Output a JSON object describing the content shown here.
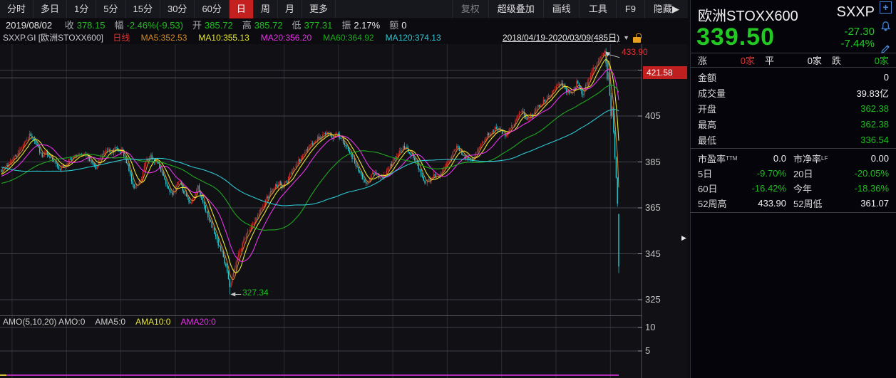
{
  "toolbar": {
    "tabs": [
      {
        "name": "fenshi",
        "label": "分时",
        "active": false
      },
      {
        "name": "multi-day",
        "label": "多日",
        "active": false
      },
      {
        "name": "1min",
        "label": "1分",
        "active": false
      },
      {
        "name": "5min",
        "label": "5分",
        "active": false
      },
      {
        "name": "15min",
        "label": "15分",
        "active": false
      },
      {
        "name": "30min",
        "label": "30分",
        "active": false
      },
      {
        "name": "60min",
        "label": "60分",
        "active": false
      },
      {
        "name": "day",
        "label": "日",
        "active": true
      },
      {
        "name": "week",
        "label": "周",
        "active": false
      },
      {
        "name": "month",
        "label": "月",
        "active": false
      },
      {
        "name": "more",
        "label": "更多",
        "active": false
      }
    ],
    "right": [
      {
        "name": "fuquan",
        "label": "复权",
        "dim": true
      },
      {
        "name": "super-overlay",
        "label": "超级叠加",
        "dim": false
      },
      {
        "name": "draw-line",
        "label": "画线",
        "dim": false
      },
      {
        "name": "tools",
        "label": "工具",
        "dim": false
      },
      {
        "name": "f9",
        "label": "F9",
        "dim": false
      },
      {
        "name": "hide",
        "label": "隐藏▶",
        "dim": false
      }
    ]
  },
  "infobar": {
    "date": "2019/08/02",
    "fields": [
      {
        "label": "收",
        "value": "378.15",
        "color": "g"
      },
      {
        "label": "幅",
        "value": "-2.46%(-9.53)",
        "color": "g"
      },
      {
        "label": "开",
        "value": "385.72",
        "color": "g"
      },
      {
        "label": "高",
        "value": "385.72",
        "color": "g"
      },
      {
        "label": "低",
        "value": "377.31",
        "color": "g"
      },
      {
        "label": "振",
        "value": "2.17%",
        "color": "w"
      },
      {
        "label": "额",
        "value": "0",
        "color": "w"
      }
    ]
  },
  "legend": {
    "symbol": "SXXP.GI [欧洲STOXX600]",
    "period": "日线",
    "mas": [
      {
        "label": "MA5:352.53",
        "color": "#cf8a2a"
      },
      {
        "label": "MA10:355.13",
        "color": "#e8e832"
      },
      {
        "label": "MA20:356.20",
        "color": "#e832e8"
      },
      {
        "label": "MA60:364.92",
        "color": "#1fa81f"
      },
      {
        "label": "MA120:374.13",
        "color": "#2ec8d2"
      }
    ],
    "range": "2018/04/19-2020/03/09(485日)"
  },
  "chart": {
    "y_axis_labels": [
      405,
      385,
      365,
      345,
      325
    ],
    "sub_axis_labels": [
      10,
      5
    ],
    "high_annotation": "433.90",
    "low_annotation": "327.34",
    "last_price_label": "421.58",
    "sub_legend": [
      {
        "text": "AMO(5,10,20) AMO:0",
        "color": "#cccccc"
      },
      {
        "text": "AMA5:0",
        "color": "#cccccc"
      },
      {
        "text": "AMA10:0",
        "color": "#e8e832"
      },
      {
        "text": "AMA20:0",
        "color": "#e832e8"
      }
    ]
  },
  "chart_data": {
    "type": "candlestick",
    "instrument": "SXXP.GI 欧洲STOXX600",
    "period": "daily",
    "date_range": "2018/04/19-2020/03/09",
    "visible_days": 485,
    "ylim": [
      322,
      436
    ],
    "grid_price_levels": [
      425,
      405,
      385,
      365,
      345,
      325
    ],
    "last_price_line": 421.58,
    "key_points": {
      "high": {
        "day": 473,
        "price": 433.9
      },
      "low": {
        "day": 179,
        "price": 327.34
      },
      "last_bar": {
        "open": 362.38,
        "high": 362.38,
        "low": 336.54,
        "close": 339.5,
        "prev_close": 366.8
      }
    },
    "up_color": "#d03030",
    "down_color": "#2ec8d2",
    "ma_series": [
      {
        "period": 5,
        "color": "#cf8a2a"
      },
      {
        "period": 10,
        "color": "#e8e832"
      },
      {
        "period": 20,
        "color": "#e832e8"
      },
      {
        "period": 60,
        "color": "#1fa81f"
      },
      {
        "period": 120,
        "color": "#2ec8d2"
      }
    ],
    "pre_close_anchors": [
      [
        -130,
        404
      ],
      [
        -100,
        396
      ],
      [
        -75,
        383
      ],
      [
        -50,
        371
      ],
      [
        -25,
        377
      ],
      [
        -5,
        379
      ]
    ],
    "close_anchors": [
      [
        0,
        381
      ],
      [
        4,
        383
      ],
      [
        10,
        387
      ],
      [
        16,
        391
      ],
      [
        22,
        396.5
      ],
      [
        26,
        394
      ],
      [
        30,
        390
      ],
      [
        32,
        387.5
      ],
      [
        35,
        389.5
      ],
      [
        39,
        387
      ],
      [
        43,
        384.5
      ],
      [
        46,
        381.5
      ],
      [
        50,
        384
      ],
      [
        54,
        386.5
      ],
      [
        59,
        387.5
      ],
      [
        62,
        388.5
      ],
      [
        67,
        387.5
      ],
      [
        71,
        384
      ],
      [
        74,
        382
      ],
      [
        78,
        388
      ],
      [
        83,
        390.5
      ],
      [
        86,
        389
      ],
      [
        90,
        391
      ],
      [
        95,
        389.5
      ],
      [
        99,
        383
      ],
      [
        102,
        377
      ],
      [
        104,
        373
      ],
      [
        107,
        375.5
      ],
      [
        110,
        378
      ],
      [
        113,
        385
      ],
      [
        117,
        387.5
      ],
      [
        120,
        385.5
      ],
      [
        124,
        383
      ],
      [
        127,
        378
      ],
      [
        130,
        374.5
      ],
      [
        134,
        371
      ],
      [
        137,
        374
      ],
      [
        139,
        377
      ],
      [
        142,
        373
      ],
      [
        145,
        370
      ],
      [
        148,
        367
      ],
      [
        152,
        372
      ],
      [
        154,
        374
      ],
      [
        157,
        369
      ],
      [
        160,
        364
      ],
      [
        163,
        360
      ],
      [
        166,
        356
      ],
      [
        168,
        352
      ],
      [
        171,
        348
      ],
      [
        174,
        344
      ],
      [
        177,
        337
      ],
      [
        179,
        330.5
      ],
      [
        182,
        337
      ],
      [
        185,
        343
      ],
      [
        188,
        348
      ],
      [
        191,
        352
      ],
      [
        195,
        356
      ],
      [
        199,
        360
      ],
      [
        202,
        363
      ],
      [
        206,
        367
      ],
      [
        210,
        371
      ],
      [
        214,
        374
      ],
      [
        218,
        376
      ],
      [
        220,
        373.5
      ],
      [
        223,
        376
      ],
      [
        227,
        380
      ],
      [
        231,
        384
      ],
      [
        235,
        387
      ],
      [
        239,
        390
      ],
      [
        243,
        393
      ],
      [
        247,
        395
      ],
      [
        251,
        396
      ],
      [
        255,
        397.5
      ],
      [
        260,
        396
      ],
      [
        263,
        397
      ],
      [
        267,
        395
      ],
      [
        270,
        392
      ],
      [
        273,
        389
      ],
      [
        277,
        385
      ],
      [
        280,
        381
      ],
      [
        283,
        377.5
      ],
      [
        286,
        375
      ],
      [
        289,
        378
      ],
      [
        293,
        381
      ],
      [
        296,
        379
      ],
      [
        299,
        377
      ],
      [
        302,
        381
      ],
      [
        306,
        384
      ],
      [
        309,
        387
      ],
      [
        312,
        390
      ],
      [
        316,
        391.5
      ],
      [
        319,
        390
      ],
      [
        322,
        388
      ],
      [
        326,
        384
      ],
      [
        329,
        380
      ],
      [
        332,
        375.5
      ],
      [
        335,
        377
      ],
      [
        339,
        379
      ],
      [
        342,
        378
      ],
      [
        345,
        381
      ],
      [
        349,
        384
      ],
      [
        352,
        387
      ],
      [
        355,
        390
      ],
      [
        358,
        391.5
      ],
      [
        361,
        389
      ],
      [
        365,
        386.5
      ],
      [
        368,
        385
      ],
      [
        371,
        388
      ],
      [
        375,
        391
      ],
      [
        378,
        394
      ],
      [
        381,
        396.5
      ],
      [
        385,
        398
      ],
      [
        388,
        400
      ],
      [
        392,
        398.5
      ],
      [
        395,
        396.5
      ],
      [
        398,
        399
      ],
      [
        402,
        402
      ],
      [
        405,
        405
      ],
      [
        408,
        407
      ],
      [
        410,
        405
      ],
      [
        413,
        403.5
      ],
      [
        416,
        405.5
      ],
      [
        419,
        408
      ],
      [
        423,
        410
      ],
      [
        426,
        412
      ],
      [
        429,
        414
      ],
      [
        433,
        416
      ],
      [
        436,
        418
      ],
      [
        439,
        419.5
      ],
      [
        442,
        417
      ],
      [
        445,
        414.5
      ],
      [
        448,
        416
      ],
      [
        451,
        420
      ],
      [
        454,
        416
      ],
      [
        456,
        414.5
      ],
      [
        458,
        418
      ],
      [
        461,
        422
      ],
      [
        464,
        425.5
      ],
      [
        467,
        428
      ],
      [
        470,
        431
      ],
      [
        473,
        433.2
      ],
      [
        474,
        428
      ],
      [
        475,
        421
      ],
      [
        476,
        424
      ],
      [
        477,
        414
      ],
      [
        478,
        405
      ],
      [
        479,
        409
      ],
      [
        480,
        398
      ],
      [
        481,
        387
      ],
      [
        482,
        378
      ],
      [
        483,
        366.8
      ],
      [
        484,
        339.5
      ]
    ],
    "sub_chart": {
      "indicator": "AMO(5,10,20)",
      "all_values_zero": true,
      "axis": [
        10,
        5
      ],
      "zero_line_color": "#e832e8",
      "left_segment_color": "#e8e832"
    }
  },
  "panel": {
    "title": "欧洲STOXX600",
    "code": "SXXP",
    "price": "339.50",
    "change": "-27.30",
    "change_pct": "-7.44%",
    "accent_up": "#e23232",
    "accent_down": "#22c922",
    "breadth": [
      {
        "label": "涨",
        "value": "0家",
        "color": "r"
      },
      {
        "label": "平",
        "value": "0家",
        "color": "w"
      },
      {
        "label": "跌",
        "value": "0家",
        "color": "g"
      }
    ],
    "stats1": [
      {
        "label": "金额",
        "value": "0",
        "color": "w"
      },
      {
        "label": "成交量",
        "value": "39.83亿",
        "color": "w"
      },
      {
        "label": "开盘",
        "value": "362.38",
        "color": "g"
      },
      {
        "label": "最高",
        "value": "362.38",
        "color": "g"
      },
      {
        "label": "最低",
        "value": "336.54",
        "color": "g"
      }
    ],
    "stats2": [
      {
        "l1": "市盈率",
        "sup1": "TTM",
        "v1": "0.0",
        "c1": "w",
        "l2": "市净率",
        "sup2": "LF",
        "v2": "0.00",
        "c2": "w"
      },
      {
        "l1": "5日",
        "sup1": "",
        "v1": "-9.70%",
        "c1": "g",
        "l2": "20日",
        "sup2": "",
        "v2": "-20.05%",
        "c2": "g"
      },
      {
        "l1": "60日",
        "sup1": "",
        "v1": "-16.42%",
        "c1": "g",
        "l2": "今年",
        "sup2": "",
        "v2": "-18.36%",
        "c2": "g"
      },
      {
        "l1": "52周高",
        "sup1": "",
        "v1": "433.90",
        "c1": "w",
        "l2": "52周低",
        "sup2": "",
        "v2": "361.07",
        "c2": "w"
      }
    ],
    "icons": [
      "add-icon",
      "alert-bell-icon",
      "edit-pencil-icon"
    ]
  }
}
